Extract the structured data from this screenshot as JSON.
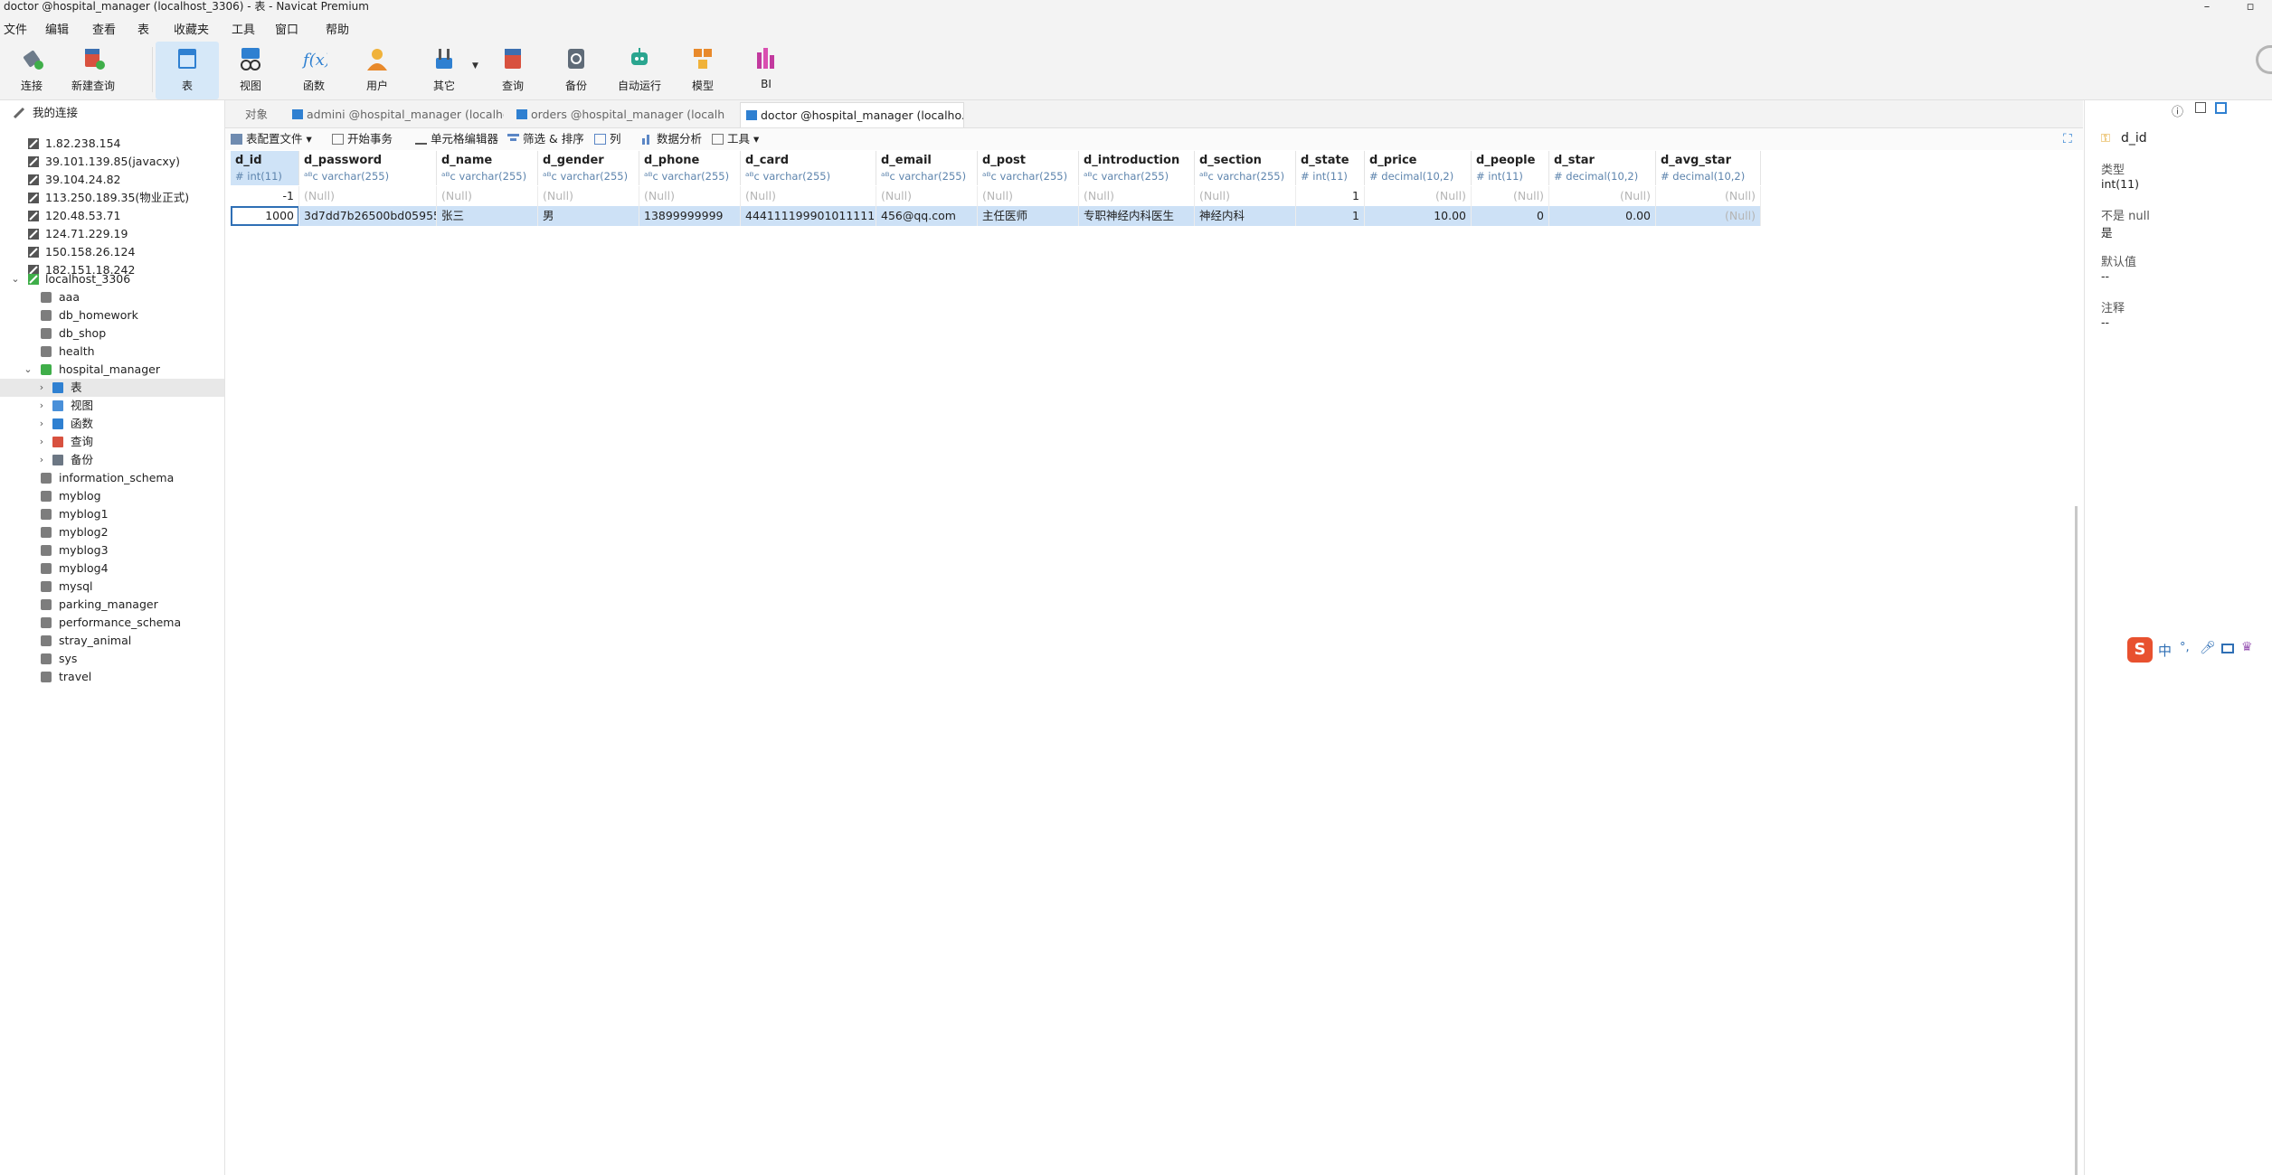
{
  "window": {
    "title": "doctor @hospital_manager (localhost_3306) - 表 - Navicat Premium"
  },
  "menu": [
    "文件",
    "编辑",
    "查看",
    "表",
    "收藏夹",
    "工具",
    "窗口",
    "帮助"
  ],
  "toolbar": {
    "connect": "连接",
    "new_query": "新建查询",
    "table": "表",
    "view": "视图",
    "function": "函数",
    "user": "用户",
    "other": "其它",
    "query": "查询",
    "backup": "备份",
    "automation": "自动运行",
    "model": "模型",
    "bi": "BI"
  },
  "sidebar": {
    "header": "我的连接",
    "connections": [
      "1.82.238.154",
      "39.101.139.85(javacxy)",
      "39.104.24.82",
      "113.250.189.35(物业正式)",
      "120.48.53.71",
      "124.71.229.19",
      "150.158.26.124",
      "182.151.18.242"
    ],
    "localhost": "localhost_3306",
    "databases_before": [
      "aaa",
      "db_homework",
      "db_shop",
      "health"
    ],
    "active_db": "hospital_manager",
    "active_db_children": [
      "表",
      "视图",
      "函数",
      "查询",
      "备份"
    ],
    "databases_after": [
      "information_schema",
      "myblog",
      "myblog1",
      "myblog2",
      "myblog3",
      "myblog4",
      "mysql",
      "parking_manager",
      "performance_schema",
      "stray_animal",
      "sys",
      "travel"
    ]
  },
  "tabs": [
    "对象",
    "admini @hospital_manager (localho...",
    "orders @hospital_manager (localho...",
    "doctor @hospital_manager (localho..."
  ],
  "subtoolbar": {
    "config": "表配置文件",
    "begin_tx": "开始事务",
    "cell_editor": "单元格编辑器",
    "filter_sort": "筛选 & 排序",
    "columns": "列",
    "analysis": "数据分析",
    "tools": "工具"
  },
  "table": {
    "columns": [
      {
        "name": "d_id",
        "type": "int(11)"
      },
      {
        "name": "d_password",
        "type": "varchar(255)"
      },
      {
        "name": "d_name",
        "type": "varchar(255)"
      },
      {
        "name": "d_gender",
        "type": "varchar(255)"
      },
      {
        "name": "d_phone",
        "type": "varchar(255)"
      },
      {
        "name": "d_card",
        "type": "varchar(255)"
      },
      {
        "name": "d_email",
        "type": "varchar(255)"
      },
      {
        "name": "d_post",
        "type": "varchar(255)"
      },
      {
        "name": "d_introduction",
        "type": "varchar(255)"
      },
      {
        "name": "d_section",
        "type": "varchar(255)"
      },
      {
        "name": "d_state",
        "type": "int(11)"
      },
      {
        "name": "d_price",
        "type": "decimal(10,2)"
      },
      {
        "name": "d_people",
        "type": "int(11)"
      },
      {
        "name": "d_star",
        "type": "decimal(10,2)"
      },
      {
        "name": "d_avg_star",
        "type": "decimal(10,2)"
      }
    ],
    "rows": [
      [
        "-1",
        "(Null)",
        "(Null)",
        "(Null)",
        "(Null)",
        "(Null)",
        "(Null)",
        "(Null)",
        "(Null)",
        "(Null)",
        "1",
        "(Null)",
        "(Null)",
        "(Null)",
        "(Null)"
      ],
      [
        "1000",
        "3d7dd7b26500bd05955",
        "张三",
        "男",
        "13899999999",
        "444111199901011111",
        "456@qq.com",
        "主任医师",
        "专职神经内科医生",
        "神经内科",
        "1",
        "10.00",
        "0",
        "0.00",
        "(Null)"
      ]
    ]
  },
  "properties": {
    "field": "d_id",
    "type_label": "类型",
    "type_value": "int(11)",
    "notnull_label": "不是 null",
    "notnull_value": "是",
    "default_label": "默认值",
    "default_value": "--",
    "comment_label": "注释",
    "comment_value": "--"
  },
  "ime": {
    "chinese": "中",
    "punct": "°,"
  }
}
